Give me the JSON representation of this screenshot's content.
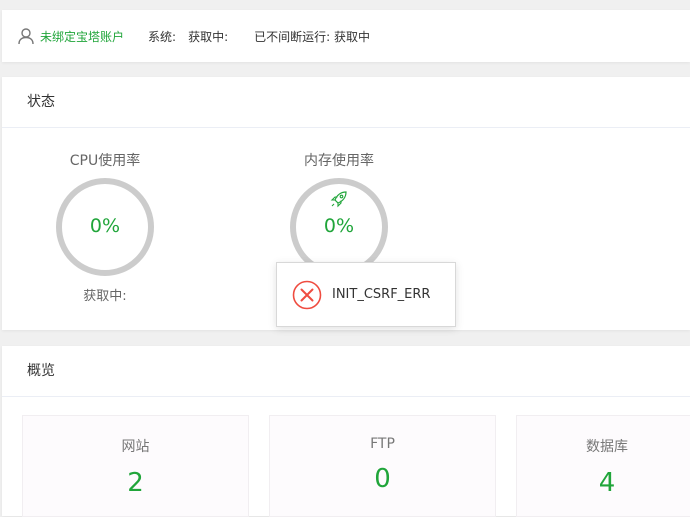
{
  "topbar": {
    "user_icon": "user-icon",
    "bind_label": "未绑定宝塔账户",
    "system_label": "系统:",
    "system_value": "获取中:",
    "uptime_label": "已不间断运行: 获取中"
  },
  "status": {
    "title": "状态",
    "cpu": {
      "title": "CPU使用率",
      "value": "0%",
      "footer": "获取中:"
    },
    "memory": {
      "title": "内存使用率",
      "value": "0%",
      "icon": "rocket-icon"
    }
  },
  "toast": {
    "icon": "error-circle-icon",
    "message": "INIT_CSRF_ERR"
  },
  "overview": {
    "title": "概览",
    "cards": [
      {
        "label": "网站",
        "value": "2"
      },
      {
        "label": "FTP",
        "value": "0"
      },
      {
        "label": "数据库",
        "value": "4"
      }
    ]
  },
  "colors": {
    "accent": "#20a53a",
    "ring": "#cccccc",
    "error": "#ef4c40"
  }
}
